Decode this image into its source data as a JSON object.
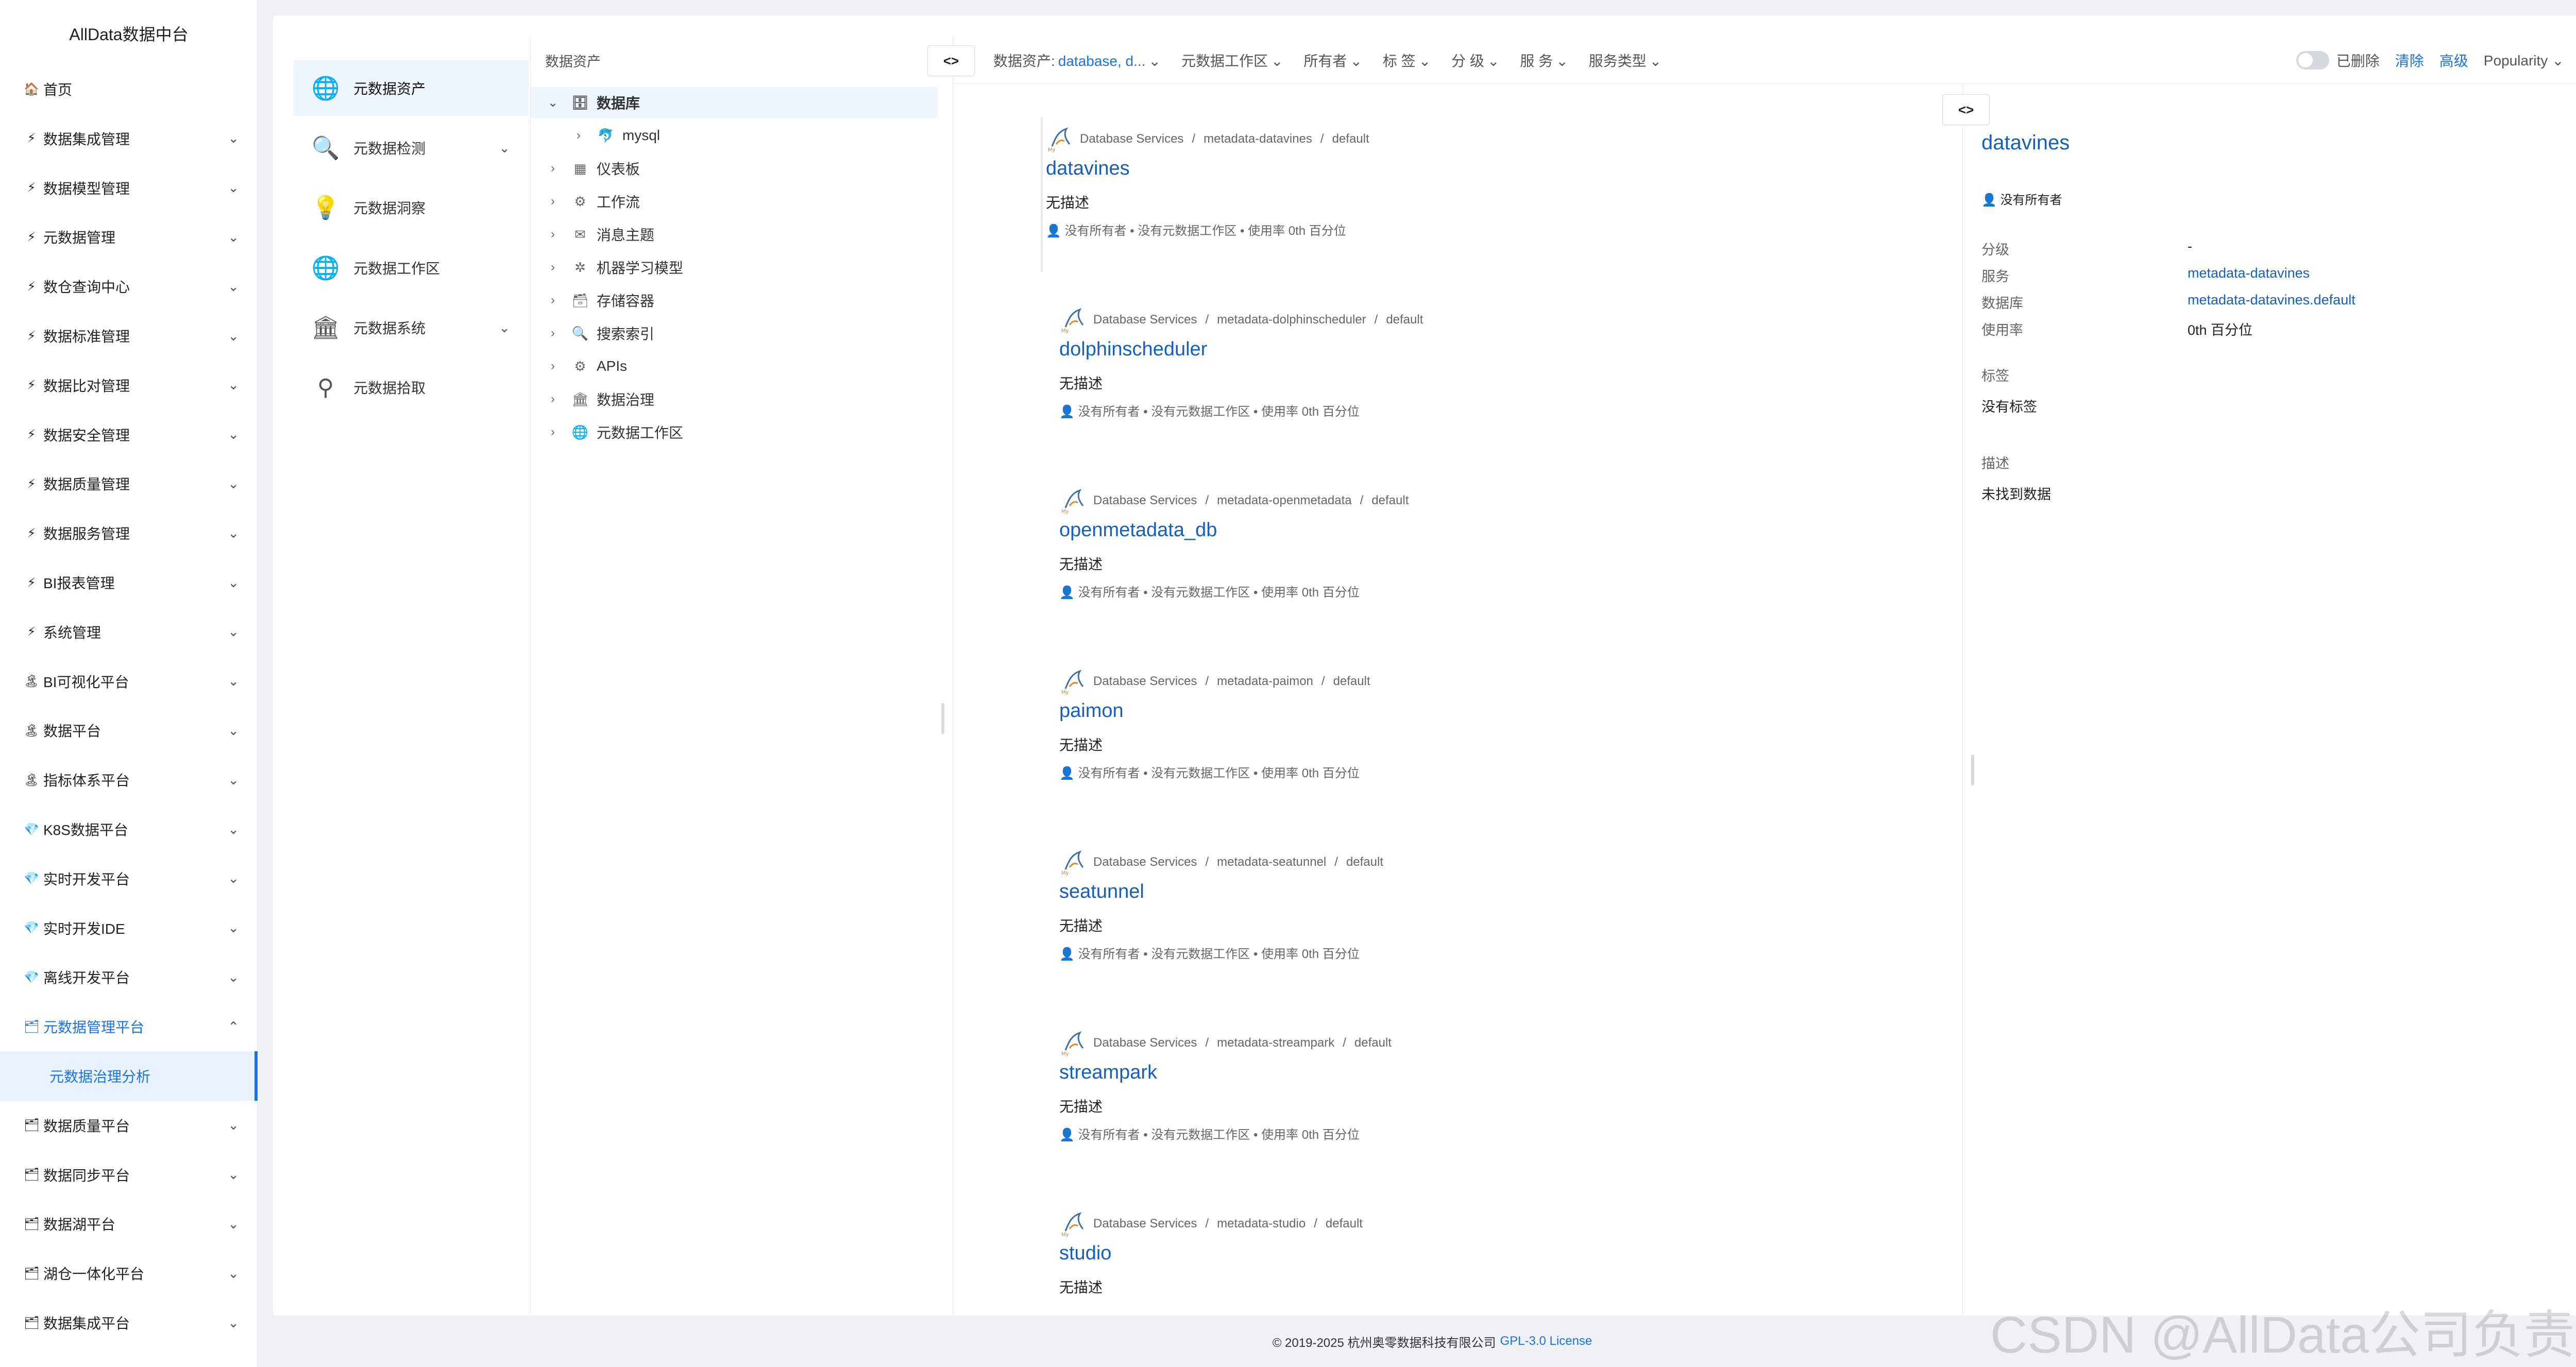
{
  "app": {
    "title": "AllData数据中台"
  },
  "nav": {
    "items": [
      {
        "icon": "🏠",
        "label": "首页",
        "chevron": ""
      },
      {
        "icon": "⚡",
        "label": "数据集成管理",
        "chevron": "⌄"
      },
      {
        "icon": "⚡",
        "label": "数据模型管理",
        "chevron": "⌄"
      },
      {
        "icon": "⚡",
        "label": "元数据管理",
        "chevron": "⌄"
      },
      {
        "icon": "⚡",
        "label": "数仓查询中心",
        "chevron": "⌄"
      },
      {
        "icon": "⚡",
        "label": "数据标准管理",
        "chevron": "⌄"
      },
      {
        "icon": "⚡",
        "label": "数据比对管理",
        "chevron": "⌄"
      },
      {
        "icon": "⚡",
        "label": "数据安全管理",
        "chevron": "⌄"
      },
      {
        "icon": "⚡",
        "label": "数据质量管理",
        "chevron": "⌄"
      },
      {
        "icon": "⚡",
        "label": "数据服务管理",
        "chevron": "⌄"
      },
      {
        "icon": "⚡",
        "label": "BI报表管理",
        "chevron": "⌄"
      },
      {
        "icon": "⚡",
        "label": "系统管理",
        "chevron": "⌄"
      },
      {
        "icon": "🏝",
        "label": "BI可视化平台",
        "chevron": "⌄"
      },
      {
        "icon": "🏝",
        "label": "数据平台",
        "chevron": "⌄"
      },
      {
        "icon": "🏝",
        "label": "指标体系平台",
        "chevron": "⌄"
      },
      {
        "icon": "💎",
        "label": "K8S数据平台",
        "chevron": "⌄"
      },
      {
        "icon": "💎",
        "label": "实时开发平台",
        "chevron": "⌄"
      },
      {
        "icon": "💎",
        "label": "实时开发IDE",
        "chevron": "⌄"
      },
      {
        "icon": "💎",
        "label": "离线开发平台",
        "chevron": "⌄"
      },
      {
        "icon": "🗂",
        "label": "元数据管理平台",
        "chevron": "⌃"
      },
      {
        "icon": "",
        "label": "元数据治理分析",
        "chevron": ""
      },
      {
        "icon": "🗂",
        "label": "数据质量平台",
        "chevron": "⌄"
      },
      {
        "icon": "🗂",
        "label": "数据同步平台",
        "chevron": "⌄"
      },
      {
        "icon": "🗂",
        "label": "数据湖平台",
        "chevron": "⌄"
      },
      {
        "icon": "🗂",
        "label": "湖仓一体化平台",
        "chevron": "⌄"
      },
      {
        "icon": "🗂",
        "label": "数据集成平台",
        "chevron": "⌄"
      }
    ]
  },
  "panel2": {
    "items": [
      {
        "icon": "🌐",
        "label": "元数据资产",
        "chevron": ""
      },
      {
        "icon": "🔍",
        "label": "元数据检测",
        "chevron": "⌄"
      },
      {
        "icon": "💡",
        "label": "元数据洞察",
        "chevron": ""
      },
      {
        "icon": "🌐",
        "label": "元数据工作区",
        "chevron": ""
      },
      {
        "icon": "🏛",
        "label": "元数据系统",
        "chevron": "⌄"
      },
      {
        "icon": "⚲",
        "label": "元数据拾取",
        "chevron": ""
      }
    ]
  },
  "tree": {
    "header": "数据资产",
    "rows": [
      {
        "arrow": "⌄",
        "icon": "🗄",
        "label": "数据库",
        "indent": 0
      },
      {
        "arrow": "›",
        "icon": "🐬",
        "label": "mysql",
        "indent": 1
      },
      {
        "arrow": "›",
        "icon": "▦",
        "label": "仪表板",
        "indent": 0
      },
      {
        "arrow": "›",
        "icon": "⚙",
        "label": "工作流",
        "indent": 0
      },
      {
        "arrow": "›",
        "icon": "✉",
        "label": "消息主题",
        "indent": 0
      },
      {
        "arrow": "›",
        "icon": "✲",
        "label": "机器学习模型",
        "indent": 0
      },
      {
        "arrow": "›",
        "icon": "🗃",
        "label": "存储容器",
        "indent": 0
      },
      {
        "arrow": "›",
        "icon": "🔍",
        "label": "搜索索引",
        "indent": 0
      },
      {
        "arrow": "›",
        "icon": "⚙",
        "label": "APIs",
        "indent": 0
      },
      {
        "arrow": "›",
        "icon": "🏛",
        "label": "数据治理",
        "indent": 0
      },
      {
        "arrow": "›",
        "icon": "🌐",
        "label": "元数据工作区",
        "indent": 0
      }
    ]
  },
  "toolbar": {
    "toggle": "<>",
    "filters": [
      {
        "label": "数据资产:",
        "value": "database, d...",
        "chevron": "⌄"
      },
      {
        "label": "元数据工作区",
        "value": "",
        "chevron": "⌄"
      },
      {
        "label": "所有者",
        "value": "",
        "chevron": "⌄"
      },
      {
        "label": "标 签",
        "value": "",
        "chevron": "⌄"
      },
      {
        "label": "分 级",
        "value": "",
        "chevron": "⌄"
      },
      {
        "label": "服 务",
        "value": "",
        "chevron": "⌄"
      },
      {
        "label": "服务类型",
        "value": "",
        "chevron": "⌄"
      }
    ],
    "deleted_label": "已删除",
    "clear_label": "清除",
    "advanced_label": "高级",
    "sort_label": "Popularity",
    "sort_chevron": "⌄",
    "sort_order_icon": "⇅"
  },
  "results": [
    {
      "service_type": "Database Services",
      "service": "metadata-datavines",
      "db": "default",
      "name": "datavines",
      "desc": "无描述",
      "owner": "没有所有者",
      "workspace": "没有元数据工作区",
      "usage": "使用率 0th 百分位"
    },
    {
      "service_type": "Database Services",
      "service": "metadata-dolphinscheduler",
      "db": "default",
      "name": "dolphinscheduler",
      "desc": "无描述",
      "owner": "没有所有者",
      "workspace": "没有元数据工作区",
      "usage": "使用率 0th 百分位"
    },
    {
      "service_type": "Database Services",
      "service": "metadata-openmetadata",
      "db": "default",
      "name": "openmetadata_db",
      "desc": "无描述",
      "owner": "没有所有者",
      "workspace": "没有元数据工作区",
      "usage": "使用率 0th 百分位"
    },
    {
      "service_type": "Database Services",
      "service": "metadata-paimon",
      "db": "default",
      "name": "paimon",
      "desc": "无描述",
      "owner": "没有所有者",
      "workspace": "没有元数据工作区",
      "usage": "使用率 0th 百分位"
    },
    {
      "service_type": "Database Services",
      "service": "metadata-seatunnel",
      "db": "default",
      "name": "seatunnel",
      "desc": "无描述",
      "owner": "没有所有者",
      "workspace": "没有元数据工作区",
      "usage": "使用率 0th 百分位"
    },
    {
      "service_type": "Database Services",
      "service": "metadata-streampark",
      "db": "default",
      "name": "streampark",
      "desc": "无描述",
      "owner": "没有所有者",
      "workspace": "没有元数据工作区",
      "usage": "使用率 0th 百分位"
    },
    {
      "service_type": "Database Services",
      "service": "metadata-studio",
      "db": "default",
      "name": "studio",
      "desc": "无描述",
      "owner": "",
      "workspace": "",
      "usage": ""
    }
  ],
  "detail": {
    "toggle": "<>",
    "title": "datavines",
    "owner": "没有所有者",
    "fields": {
      "tier_label": "分级",
      "tier_value": "-",
      "service_label": "服务",
      "service_value": "metadata-datavines",
      "database_label": "数据库",
      "database_value": "metadata-datavines.default",
      "usage_label": "使用率",
      "usage_value": "0th 百分位"
    },
    "tags_label": "标签",
    "tags_value": "没有标签",
    "desc_label": "描述",
    "desc_value": "未找到数据"
  },
  "footer": {
    "copyright": "© 2019-2025 杭州奥零数据科技有限公司",
    "license": "GPL-3.0 License"
  },
  "watermark": "CSDN @AllData公司负责人",
  "colors": {
    "accent": "#1a73e8",
    "link": "#1560bd",
    "page_bg": "#eff1f4",
    "selected_bg": "#eef5ff"
  }
}
